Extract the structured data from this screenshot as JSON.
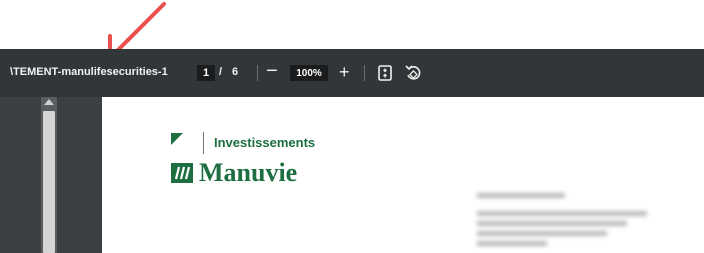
{
  "annotation": {
    "arrow_color": "#e8514d"
  },
  "toolbar": {
    "doc_title": "\\TEMENT-manulifesecurities-1",
    "page_current": "1",
    "page_separator": "/",
    "page_total": "6",
    "zoom_out_label": "−",
    "zoom_value": "100%",
    "zoom_in_label": "+",
    "fit_icon": "fit-to-page-icon",
    "rotate_icon": "rotate-icon"
  },
  "document": {
    "logo_top_text": "Investissements",
    "logo_main_text": "Manuvie",
    "brand_color": "#1d6f42"
  }
}
